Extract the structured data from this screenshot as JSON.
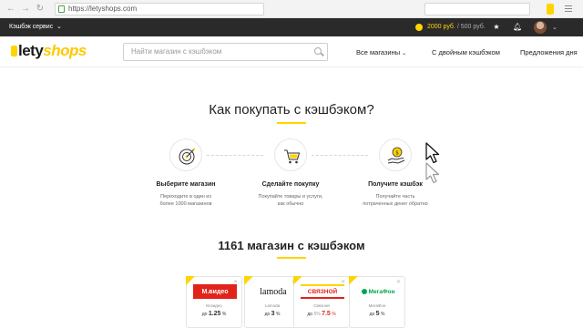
{
  "browser": {
    "url": "https://letyshops.com"
  },
  "topbar": {
    "service_label": "Кэшбэк сервис",
    "balance_amount": "2000 руб.",
    "balance_sep": " / ",
    "balance_pending": "500 руб."
  },
  "header": {
    "logo_main": "lety",
    "logo_accent": "shops",
    "search_placeholder": "Найти магазин с кэшбэком",
    "nav": [
      "Все магазины",
      "С двойным кэшбэком",
      "Предложения дня"
    ]
  },
  "how_it_works": {
    "title": "Как покупать с кэшбэком?",
    "steps": [
      {
        "title": "Выберите магазин",
        "text_line1": "Переходите в один из",
        "text_line2": "более 1000 магазинов"
      },
      {
        "title": "Сделайте покупку",
        "text_line1": "Покупайте товары и услуги,",
        "text_line2": "как обычно"
      },
      {
        "title": "Получите кэшбэк",
        "text_line1": "Получайте часть",
        "text_line2": "потраченных денег обратно"
      }
    ]
  },
  "stores": {
    "title": "1161 магазин с кэшбэком",
    "cards": [
      {
        "logo": "М.видео",
        "name": "М.видео",
        "prefix": "до",
        "value": "1.25",
        "unit": "%"
      },
      {
        "logo": "lamoda",
        "name": "Lamoda",
        "prefix": "до",
        "value": "3",
        "unit": "%"
      },
      {
        "logo": "СВЯЗНОЙ",
        "name": "Связной",
        "prefix": "до",
        "old": "5%",
        "value": "7.5",
        "unit": "%"
      },
      {
        "logo": "МегаФон",
        "name": "МегаФон",
        "prefix": "до",
        "value": "5",
        "unit": "%"
      }
    ]
  },
  "colors": {
    "accent": "#ffd400",
    "dark_bar": "#2a2a2a",
    "red": "#e2231a"
  }
}
